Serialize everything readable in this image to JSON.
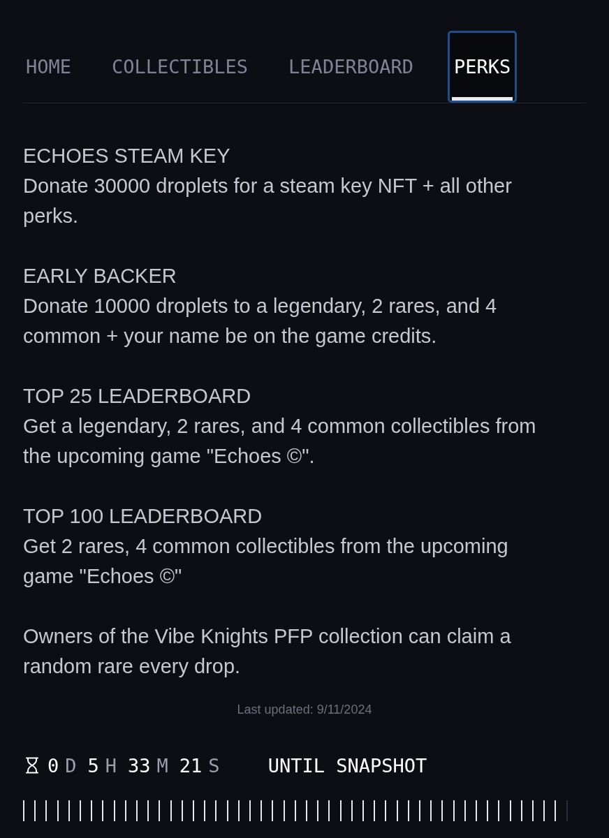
{
  "tabs": [
    {
      "label": "HOME",
      "selected": false
    },
    {
      "label": "COLLECTIBLES",
      "selected": false
    },
    {
      "label": "LEADERBOARD",
      "selected": false
    },
    {
      "label": "PERKS",
      "selected": true
    }
  ],
  "perks": [
    {
      "title": "ECHOES STEAM KEY",
      "description": "Donate 30000 droplets for a steam key NFT + all other perks."
    },
    {
      "title": "EARLY BACKER",
      "description": "Donate 10000 droplets to a legendary, 2 rares, and 4 common + your name be on the game credits."
    },
    {
      "title": "TOP 25 LEADERBOARD",
      "description": "Get a legendary, 2 rares, and 4 common collectibles from the upcoming game \"Echoes ©\"."
    },
    {
      "title": "TOP 100 LEADERBOARD",
      "description": "Get 2 rares, 4 common collectibles from the upcoming game \"Echoes ©\""
    }
  ],
  "note": "Owners of the Vibe Knights PFP collection can claim a random rare every drop.",
  "last_updated": "Last updated: 9/11/2024",
  "countdown": {
    "units": [
      {
        "value": "0",
        "unit": "D"
      },
      {
        "value": "5",
        "unit": "H"
      },
      {
        "value": "33",
        "unit": "M"
      },
      {
        "value": "21",
        "unit": "S"
      }
    ],
    "label": "UNTIL SNAPSHOT"
  },
  "snapshot_progress": {
    "level": 0.98
  }
}
